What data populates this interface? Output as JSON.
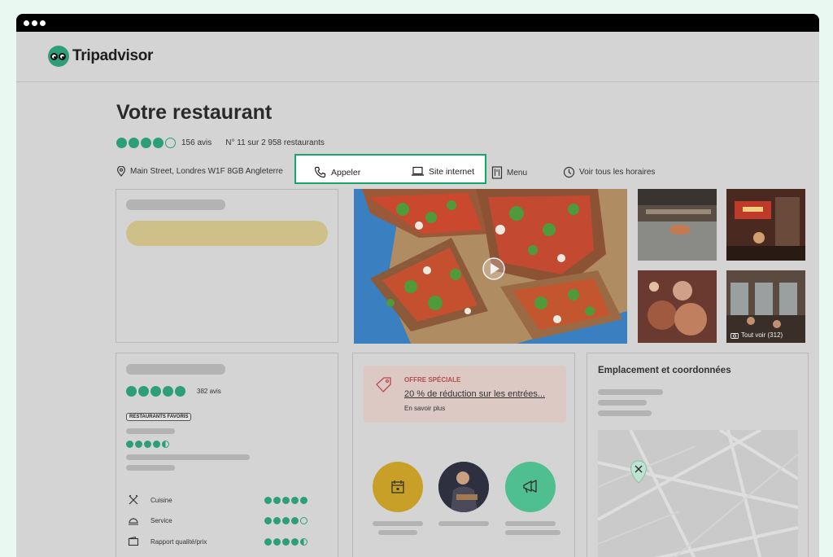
{
  "window": {
    "controls": [
      "close",
      "minimize",
      "maximize"
    ]
  },
  "header": {
    "brand": "Tripadvisor",
    "logo_icon": "owl-eyes-icon"
  },
  "restaurant": {
    "name": "Votre restaurant",
    "rating": 4,
    "rating_max": 5,
    "reviews": "156 avis",
    "ranking": "N° 11 sur 2 958 restaurants",
    "address": "Main Street, Londres W1F 8GB Angleterre",
    "call_label": "Appeler",
    "website_label": "Site internet",
    "menu_label": "Menu",
    "hours_label": "Voir tous les horaires"
  },
  "gallery": {
    "see_all": "Tout voir (312)"
  },
  "reviews_card": {
    "overall_rating": 5,
    "review_count": "382 avis",
    "badge": "RESTAURANTS FAVORIS",
    "small_rating": 4.5,
    "categories": [
      {
        "label": "Cuisine",
        "icon": "fork-knife-icon",
        "rating": 5
      },
      {
        "label": "Service",
        "icon": "cloche-icon",
        "rating": 4
      },
      {
        "label": "Rapport qualité/prix",
        "icon": "wallet-icon",
        "rating": 4.5
      }
    ]
  },
  "offer": {
    "tag": "OFFRE SPÉCIALE",
    "title": "20 % de réduction sur les entrées...",
    "more": "En savoir plus"
  },
  "location": {
    "title": "Emplacement et coordonnées"
  },
  "colors": {
    "brand_green": "#2e9e78",
    "highlight": "#12a86a",
    "offer_red": "#b84a4a",
    "yellow_pill": "#cfc08a",
    "gold_circle": "#c8a028"
  }
}
